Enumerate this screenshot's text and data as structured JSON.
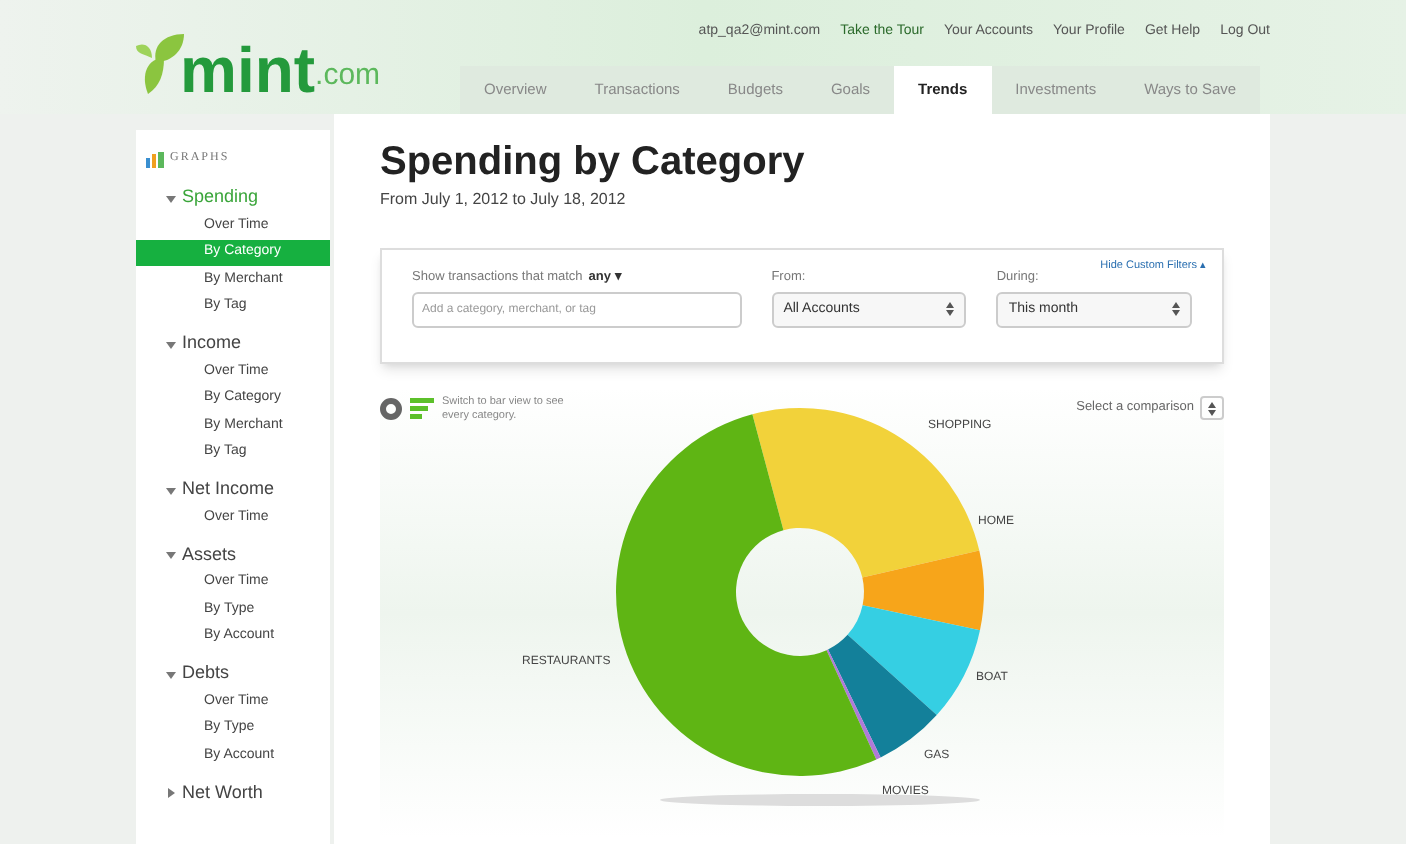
{
  "logo": {
    "word": "mint",
    "suffix": ".com"
  },
  "top_links": [
    "atp_qa2@mint.com",
    "Take the Tour",
    "Your Accounts",
    "Your Profile",
    "Get Help",
    "Log Out"
  ],
  "tabs": [
    {
      "label": "Overview",
      "selected": false
    },
    {
      "label": "Transactions",
      "selected": false
    },
    {
      "label": "Budgets",
      "selected": false
    },
    {
      "label": "Goals",
      "selected": false
    },
    {
      "label": "Trends",
      "selected": true
    },
    {
      "label": "Investments",
      "selected": false
    },
    {
      "label": "Ways to Save",
      "selected": false
    }
  ],
  "sidebar": {
    "heading": "GRAPHS",
    "groups": [
      {
        "label": "Spending",
        "expanded": true,
        "active": true,
        "children": [
          {
            "label": "Over Time",
            "selected": false
          },
          {
            "label": "By Category",
            "selected": true
          },
          {
            "label": "By Merchant",
            "selected": false
          },
          {
            "label": "By Tag",
            "selected": false
          }
        ]
      },
      {
        "label": "Income",
        "expanded": true,
        "active": false,
        "children": [
          {
            "label": "Over Time",
            "selected": false
          },
          {
            "label": "By Category",
            "selected": false
          },
          {
            "label": "By Merchant",
            "selected": false
          },
          {
            "label": "By Tag",
            "selected": false
          }
        ]
      },
      {
        "label": "Net Income",
        "expanded": true,
        "active": false,
        "children": [
          {
            "label": "Over Time",
            "selected": false
          }
        ]
      },
      {
        "label": "Assets",
        "expanded": true,
        "active": false,
        "children": [
          {
            "label": "Over Time",
            "selected": false
          },
          {
            "label": "By Type",
            "selected": false
          },
          {
            "label": "By Account",
            "selected": false
          }
        ]
      },
      {
        "label": "Debts",
        "expanded": true,
        "active": false,
        "children": [
          {
            "label": "Over Time",
            "selected": false
          },
          {
            "label": "By Type",
            "selected": false
          },
          {
            "label": "By Account",
            "selected": false
          }
        ]
      },
      {
        "label": "Net Worth",
        "expanded": false,
        "active": false
      }
    ]
  },
  "title": "Spending by Category",
  "subtitle": "From July 1, 2012 to July 18, 2012",
  "filters": {
    "hide_link": "Hide Custom Filters ▴",
    "match_label": "Show transactions that match",
    "match_value": "any ▾",
    "search": {
      "placeholder": "Add a category, merchant, or tag"
    },
    "from": {
      "label": "From:",
      "value": "All Accounts"
    },
    "during": {
      "label": "During:",
      "value": "This month"
    }
  },
  "view_hint": "Switch to bar view to see every category.",
  "comparison": "Select a comparison",
  "slices": [
    {
      "label": "SHOPPING",
      "color": "#f2d23a"
    },
    {
      "label": "HOME",
      "color": "#f7a51a"
    },
    {
      "label": "BOAT",
      "color": "#35cfe3"
    },
    {
      "label": "GAS",
      "color": "#13809a"
    },
    {
      "label": "MOVIES",
      "color": "#b07ad8"
    },
    {
      "label": "RESTAURANTS",
      "color": "#5fb514"
    }
  ]
}
